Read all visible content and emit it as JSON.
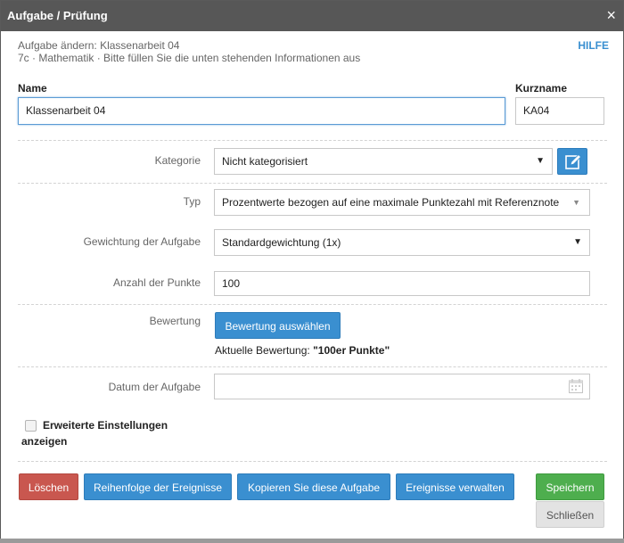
{
  "dialog": {
    "title": "Aufgabe / Prüfung",
    "close": "×",
    "subtitle_line1": "Aufgabe ändern: Klassenarbeit 04",
    "subtitle_line2": "7c · Mathematik · Bitte füllen Sie die unten stehenden Informationen aus",
    "help": "HILFE"
  },
  "form": {
    "name_label": "Name",
    "name_value": "Klassenarbeit 04",
    "short_label": "Kurzname",
    "short_value": "KA04",
    "category_label": "Kategorie",
    "category_value": "Nicht kategorisiert",
    "type_label": "Typ",
    "type_value": "Prozentwerte bezogen auf eine maximale Punktezahl mit Referenznote",
    "weight_label": "Gewichtung der Aufgabe",
    "weight_value": "Standardgewichtung (1x)",
    "points_label": "Anzahl der Punkte",
    "points_value": "100",
    "rating_label": "Bewertung",
    "rating_button": "Bewertung auswählen",
    "current_rating_prefix": "Aktuelle Bewertung:",
    "current_rating_value": "\"100er Punkte\"",
    "date_label": "Datum der Aufgabe",
    "date_value": "",
    "advanced_line1": "Erweiterte Einstellungen",
    "advanced_line2": "anzeigen",
    "advanced_checked": false
  },
  "actions": {
    "delete": "Löschen",
    "order": "Reihenfolge der Ereignisse",
    "copy": "Kopieren Sie diese Aufgabe",
    "manage": "Ereignisse verwalten",
    "save": "Speichern",
    "close": "Schließen"
  },
  "colors": {
    "titlebar": "#575757",
    "primary": "#3a8fd0",
    "danger": "#c9574f",
    "success": "#4eae4e",
    "neutral": "#e3e3e3"
  }
}
